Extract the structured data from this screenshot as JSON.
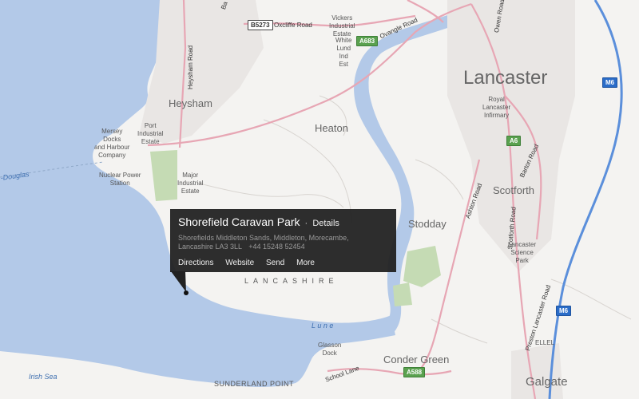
{
  "popup": {
    "title": "Shorefield Caravan Park",
    "separator": "·",
    "details": "Details",
    "address_line1": "Shorefields Middleton Sands, Middleton, Morecambe,",
    "address_line2": "Lancashire LA3 3LL",
    "phone": "+44 15248 52454",
    "actions": [
      "Directions",
      "Website",
      "Send",
      "More"
    ]
  },
  "places": {
    "lancaster": "Lancaster",
    "heysham": "Heysham",
    "heaton": "Heaton",
    "stodday": "Stodday",
    "scotforth": "Scotforth",
    "galgate": "Galgate",
    "conder_green": "Conder Green",
    "ellel": "ELLEL"
  },
  "pois": {
    "vickers": [
      "Vickers",
      "Industrial",
      "Estate"
    ],
    "white_lund": [
      "White",
      "Lund",
      "Ind",
      "Est"
    ],
    "mersey": [
      "Mersey",
      "Docks",
      "and Harbour",
      "Company"
    ],
    "port_industrial": [
      "Port",
      "Industrial",
      "Estate"
    ],
    "nuclear": [
      "Nuclear Power",
      "Station"
    ],
    "major_industrial": [
      "Major",
      "Industrial",
      "Estate"
    ],
    "royal_infirmary": [
      "Royal",
      "Lancaster",
      "Infirmary"
    ],
    "science_park": [
      "Lancaster",
      "Science",
      "Park"
    ],
    "glasson_dock": [
      "Glasson",
      "Dock"
    ]
  },
  "water": {
    "irish_sea": "Irish Sea",
    "lune": "L u n e",
    "douglas": "-Douglas"
  },
  "region": "LANCASHIRE",
  "features": {
    "sunderland_point": "SUNDERLAND POINT"
  },
  "roads": {
    "oxcliffe": "Oxcliffe Road",
    "ovangle": "Ovangle Road",
    "heysham_road": "Heysham Road",
    "ashton": "Ashton Road",
    "scotforth_road": "Scotforth Road",
    "barton": "Barton Road",
    "preston_lancaster": "Preston Lancaster Road",
    "owen": "Owen Road",
    "school_lane": "School Lane",
    "bay": "Ba"
  },
  "shields": {
    "b5273": "B5273",
    "a683": "A683",
    "a6": "A6",
    "m6_top": "M6",
    "m6_mid": "M6",
    "a588": "A588"
  },
  "colors": {
    "sea": "#b3c9e8",
    "land": "#f4f3f1",
    "park": "#c5dbb4",
    "road_major": "#e7a6b4",
    "motorway": "#5b8fdb",
    "popup_bg": "#222222"
  }
}
